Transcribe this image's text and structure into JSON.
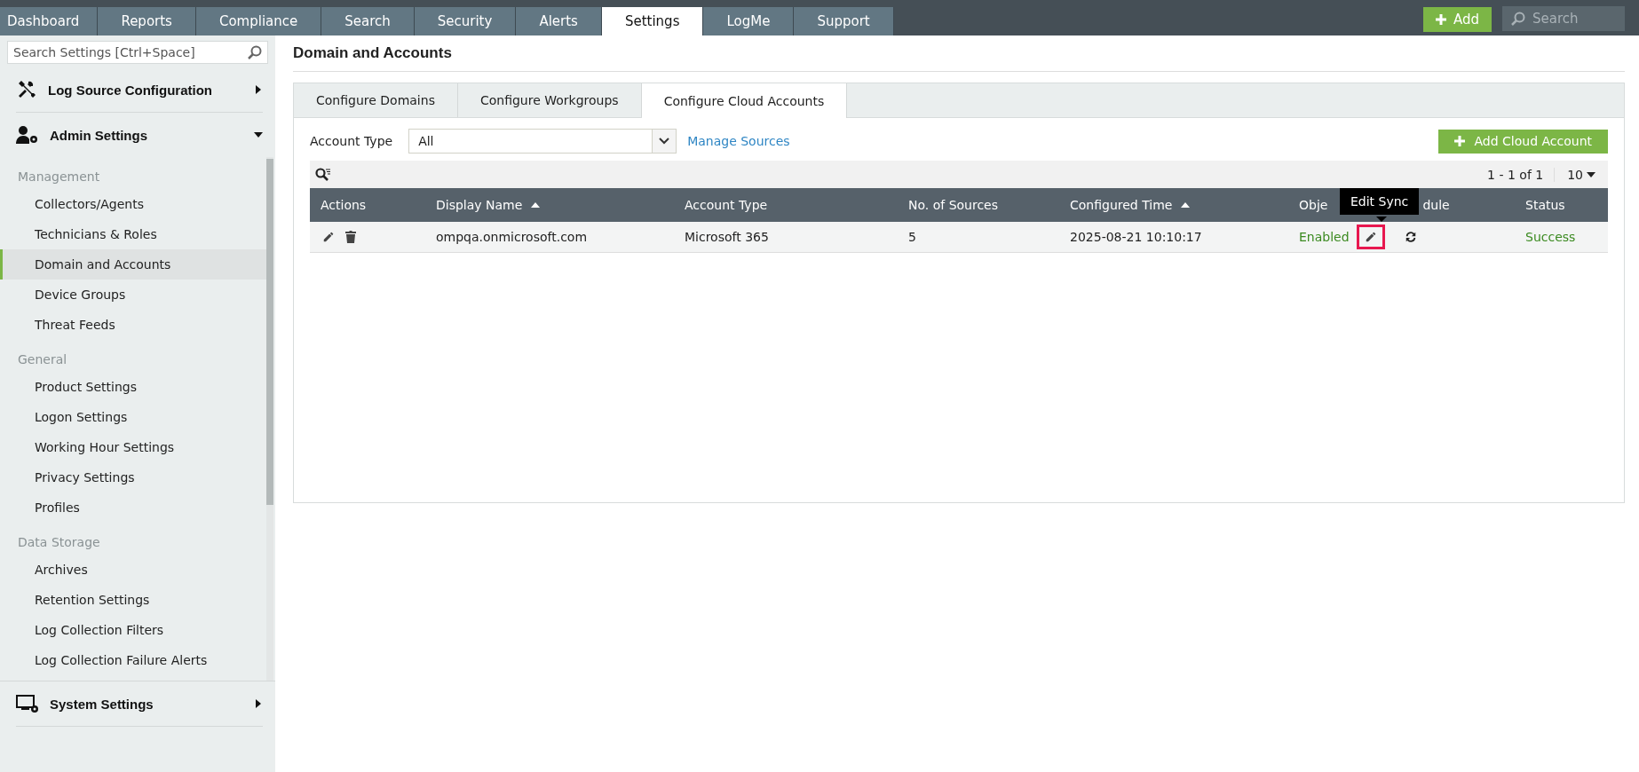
{
  "nav": {
    "tabs": [
      {
        "label": "Dashboard",
        "selected": false
      },
      {
        "label": "Reports",
        "selected": false
      },
      {
        "label": "Compliance",
        "selected": false
      },
      {
        "label": "Search",
        "selected": false
      },
      {
        "label": "Security",
        "selected": false
      },
      {
        "label": "Alerts",
        "selected": false
      },
      {
        "label": "Settings",
        "selected": true
      },
      {
        "label": "LogMe",
        "selected": false
      },
      {
        "label": "Support",
        "selected": false
      }
    ],
    "add_button": "Add",
    "search": {
      "placeholder": "Search"
    }
  },
  "sidebar": {
    "search": {
      "placeholder": "Search Settings [Ctrl+Space]"
    },
    "menus": [
      {
        "kind": "tools",
        "label": "Log Source Configuration",
        "expanded": false
      },
      {
        "kind": "admin",
        "label": "Admin Settings",
        "expanded": true,
        "groups": [
          {
            "heading": "Management",
            "items": [
              {
                "label": "Collectors/Agents",
                "selected": false
              },
              {
                "label": "Technicians & Roles",
                "selected": false
              },
              {
                "label": "Domain and Accounts",
                "selected": true
              },
              {
                "label": "Device Groups",
                "selected": false
              },
              {
                "label": "Threat Feeds",
                "selected": false
              }
            ]
          },
          {
            "heading": "General",
            "items": [
              {
                "label": "Product Settings",
                "selected": false
              },
              {
                "label": "Logon Settings",
                "selected": false
              },
              {
                "label": "Working Hour Settings",
                "selected": false
              },
              {
                "label": "Privacy Settings",
                "selected": false
              },
              {
                "label": "Profiles",
                "selected": false
              }
            ]
          },
          {
            "heading": "Data Storage",
            "items": [
              {
                "label": "Archives",
                "selected": false
              },
              {
                "label": "Retention Settings",
                "selected": false
              },
              {
                "label": "Log Collection Filters",
                "selected": false
              },
              {
                "label": "Log Collection Failure Alerts",
                "selected": false
              }
            ]
          }
        ]
      },
      {
        "kind": "system",
        "label": "System Settings",
        "expanded": false
      }
    ]
  },
  "page_title": "Domain and Accounts",
  "tabs": [
    {
      "label": "Configure Domains",
      "selected": false
    },
    {
      "label": "Configure Workgroups",
      "selected": false
    },
    {
      "label": "Configure Cloud Accounts",
      "selected": true
    }
  ],
  "filter": {
    "label": "Account Type",
    "value": "All",
    "link": "Manage Sources"
  },
  "add_cloud_account": "Add Cloud Account",
  "pagination": {
    "range": "1 - 1 of 1",
    "page_size": "10"
  },
  "table": {
    "columns": [
      {
        "label": "Actions",
        "sorted": false
      },
      {
        "label": "Display Name",
        "sorted": true
      },
      {
        "label": "Account Type",
        "sorted": false
      },
      {
        "label": "No. of Sources",
        "sorted": false
      },
      {
        "label": "Configured Time",
        "sorted": true
      },
      {
        "label": "Obje",
        "label_end": "dule",
        "sorted": false
      },
      {
        "label": "Status",
        "sorted": false
      }
    ],
    "rows": [
      {
        "display_name": "ompqa.onmicrosoft.com",
        "account_type": "Microsoft 365",
        "sources": "5",
        "configured_time": "2025-08-21 10:10:17",
        "sync": "Enabled",
        "edit_highlighted": true,
        "status": "Success"
      }
    ]
  },
  "tooltip": "Edit Sync"
}
